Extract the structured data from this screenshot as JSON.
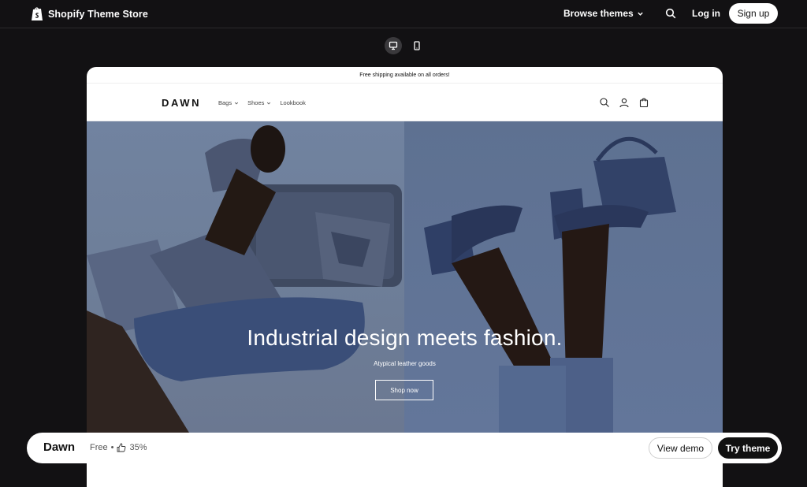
{
  "app": {
    "brand": "Shopify Theme Store",
    "nav": {
      "browse_label": "Browse themes",
      "login_label": "Log in",
      "signup_label": "Sign up"
    },
    "device_toggle": {
      "selected": "desktop"
    }
  },
  "preview": {
    "announcement": "Free shipping available on all orders!",
    "logo": "DAWN",
    "nav_items": [
      {
        "label": "Bags",
        "has_dropdown": true
      },
      {
        "label": "Shoes",
        "has_dropdown": true
      },
      {
        "label": "Lookbook",
        "has_dropdown": false
      }
    ],
    "hero": {
      "title": "Industrial design meets fashion.",
      "subtitle": "Atypical leather goods",
      "button": "Shop now"
    }
  },
  "theme_bar": {
    "name": "Dawn",
    "price": "Free",
    "separator": "•",
    "rating": "35%",
    "view_demo": "View demo",
    "try_theme": "Try theme"
  },
  "colors": {
    "page_bg": "#121113",
    "accent_dark": "#111111",
    "hero_blue": "#5d7089"
  },
  "icons": [
    "shopify-bag-icon",
    "chevron-down-icon",
    "search-icon",
    "desktop-icon",
    "mobile-icon",
    "account-icon",
    "cart-icon",
    "thumbs-up-icon"
  ]
}
